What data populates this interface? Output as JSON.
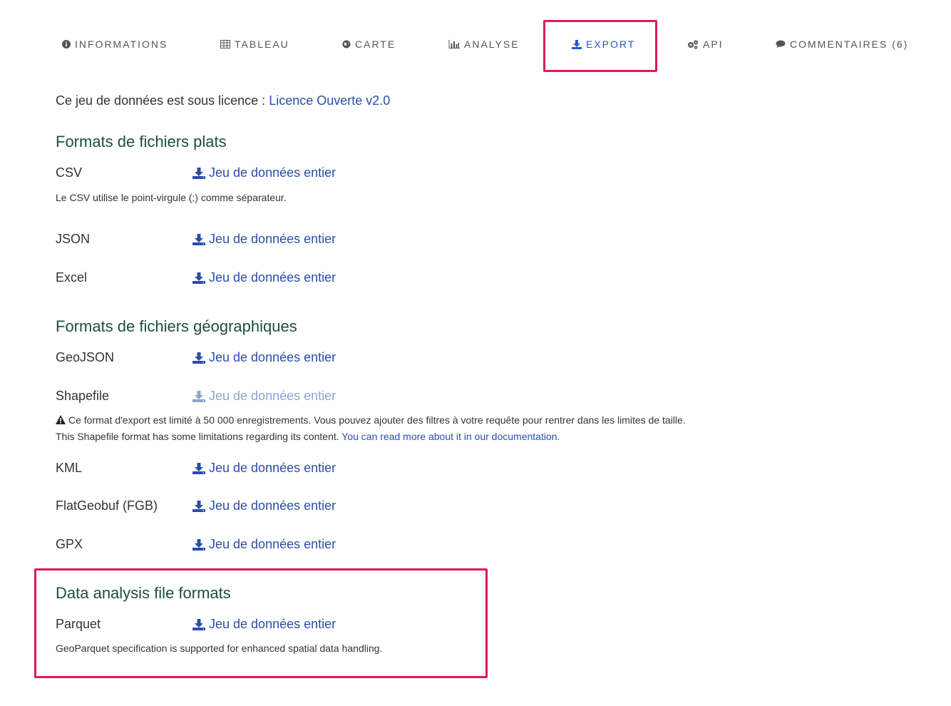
{
  "tabs": {
    "informations": "INFORMATIONS",
    "tableau": "TABLEAU",
    "carte": "CARTE",
    "analyse": "ANALYSE",
    "export": "EXPORT",
    "api": "API",
    "commentaires": "COMMENTAIRES (6)"
  },
  "license": {
    "text": "Ce jeu de données est sous licence : ",
    "link": "Licence Ouverte v2.0"
  },
  "flat": {
    "title": "Formats de fichiers plats",
    "csv": "CSV",
    "csv_note": "Le CSV utilise le point-virgule (;) comme séparateur.",
    "json": "JSON",
    "excel": "Excel"
  },
  "geo": {
    "title": "Formats de fichiers géographiques",
    "geojson": "GeoJSON",
    "shapefile": "Shapefile",
    "shapefile_warning": "Ce format d'export est limité à 50 000 enregistrements. Vous pouvez ajouter des filtres à votre requête pour rentrer dans les limites de taille.",
    "shapefile_info": "This Shapefile format has some limitations regarding its content. ",
    "shapefile_doc_link": "You can read more about it in our documentation.",
    "kml": "KML",
    "fgb": "FlatGeobuf (FGB)",
    "gpx": "GPX"
  },
  "analysis": {
    "title": "Data analysis file formats",
    "parquet": "Parquet",
    "parquet_note": "GeoParquet specification is supported for enhanced spatial data handling."
  },
  "download_label": "Jeu de données entier",
  "colors": {
    "active_tab": "#2855c4",
    "link": "#2a4ea6",
    "section_title": "#1c4f3c",
    "highlight": "#e0185c"
  }
}
